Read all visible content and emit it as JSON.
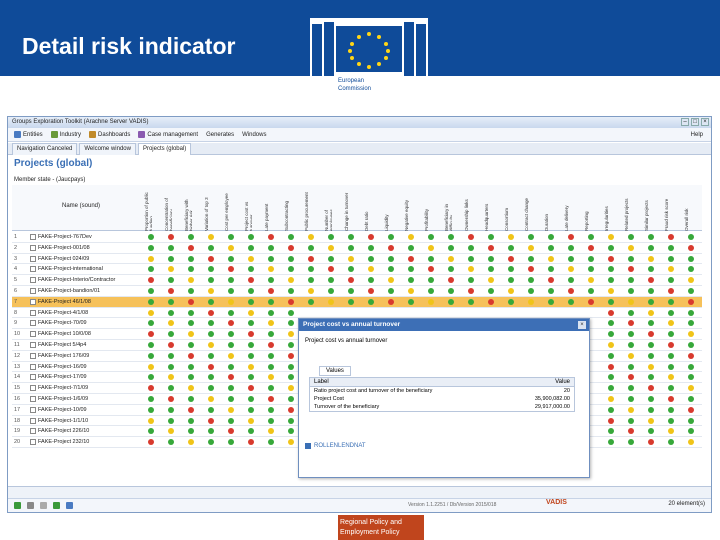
{
  "slide": {
    "title": "Detail risk indicator",
    "ec_caption_line1": "European",
    "ec_caption_line2": "Commission",
    "footer_line1": "Regional Policy and",
    "footer_line2": "Employment Policy"
  },
  "colors": {
    "banner": "#0f4b99",
    "footer": "#c0451d",
    "green": "#37a83a",
    "red": "#d83a2e",
    "yellow": "#f0c418",
    "selected_row": "#f6c15a"
  },
  "app": {
    "title": "Groups Exploration Toolkit (Arachne Server VADIS)",
    "menu": [
      "Entities",
      "Industry",
      "Dashboards",
      "Case management",
      "Generates",
      "Windows"
    ],
    "help": "Help",
    "tabs": [
      "Navigation Canceled",
      "Welcome window",
      "Projects (global)"
    ],
    "projects_title": "Projects (global)",
    "member_state": "Member state - (Jaucpays)",
    "name_header": "Name (sound)",
    "column_headers": [
      "Proportion of public funding",
      "Concentration of beneficiary",
      "Beneficiary with higher risk",
      "Variation of top 3",
      "Cost per employee",
      "Project cost vs turnover",
      "Late payment",
      "Subcontracting",
      "Public procurement",
      "Number of employees",
      "Change in turnover",
      "Debt ratio",
      "Liquidity",
      "Negative equity",
      "Profitability",
      "Beneficiary in difficulty",
      "Ownership links",
      "Headquarters",
      "Consortium",
      "Contract change",
      "Duration",
      "Late delivery",
      "Reporting",
      "Irregularities",
      "Related projects",
      "Similar projects",
      "Fraud risk score",
      "Overall risk"
    ],
    "rows": [
      {
        "id": "1",
        "name": "FAKE-Project-767Dev"
      },
      {
        "id": "2",
        "name": "FAKE-Project-001/08"
      },
      {
        "id": "3",
        "name": "FAKE-Project 024/09"
      },
      {
        "id": "4",
        "name": "FAKE-Project-international"
      },
      {
        "id": "5",
        "name": "FAKE-Project-Interio/Contractor"
      },
      {
        "id": "6",
        "name": "FAKE-Project-bandion/01"
      },
      {
        "id": "7",
        "name": "FAKE-Project 46/1/08"
      },
      {
        "id": "8",
        "name": "FAKE-Project-4/1/08"
      },
      {
        "id": "9",
        "name": "FAKE-Project-70/09"
      },
      {
        "id": "10",
        "name": "FAKE-Project 10/0/08"
      },
      {
        "id": "11",
        "name": "FAKE-Project 5/4p4"
      },
      {
        "id": "12",
        "name": "FAKE-Project 176/09"
      },
      {
        "id": "13",
        "name": "FAKE-Project-16/09"
      },
      {
        "id": "14",
        "name": "FAKE-Project-17/09"
      },
      {
        "id": "15",
        "name": "FAKE-Project-7/1/09"
      },
      {
        "id": "16",
        "name": "FAKE-Project-1/6/09"
      },
      {
        "id": "17",
        "name": "FAKE-Project-10/09"
      },
      {
        "id": "18",
        "name": "FAKE-Project-1/1/10"
      },
      {
        "id": "19",
        "name": "FAKE-Project 226/10"
      },
      {
        "id": "20",
        "name": "FAKE-Project 232/10"
      }
    ],
    "elements_count": "20 element(s)",
    "version": "Version 1.1.2251 / Db/Version 2015/018",
    "vendor": "VADIS"
  },
  "dialog": {
    "title": "Project cost vs annual turnover",
    "subtitle": "Project cost vs annual turnover",
    "tab": "Values",
    "col_label": "Label",
    "col_value": "Value",
    "rows": [
      {
        "label": "Ratio project cost and turnover of the beneficiary",
        "value": "20"
      },
      {
        "label": "Project Cost",
        "value": "35,900,082.00"
      },
      {
        "label": "Turnover of the beneficiary",
        "value": "29,917,000.00"
      }
    ],
    "footer_link": "ROLLENLENDNAT"
  }
}
